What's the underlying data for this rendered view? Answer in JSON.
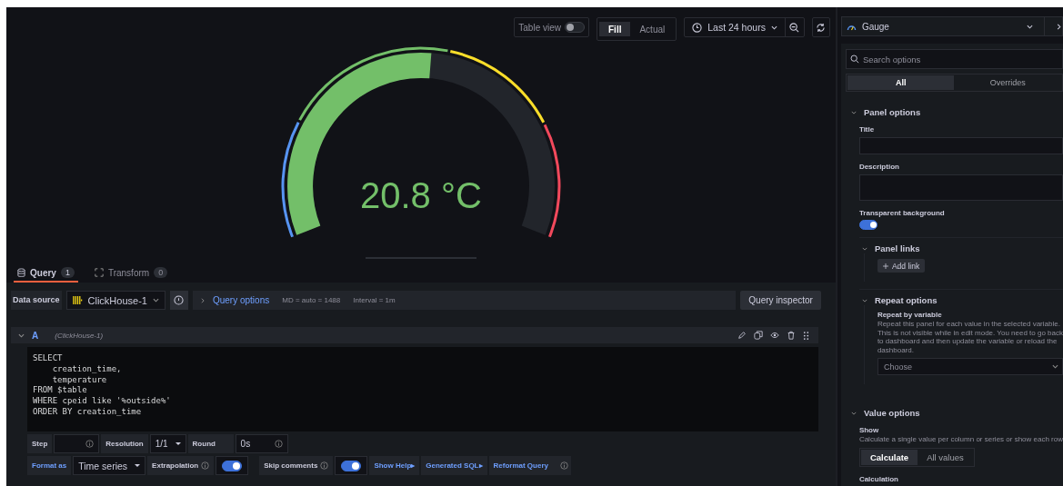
{
  "toolbar": {
    "table_view": {
      "label": "Table view",
      "on": false
    },
    "modes": [
      {
        "label": "Fill",
        "selected": true
      },
      {
        "label": "Actual",
        "selected": false
      }
    ],
    "time_range": "Last 24 hours"
  },
  "gauge": {
    "value": "20.8 °C",
    "level": 0.52
  },
  "query_tabs": [
    {
      "label": "Query",
      "count": "1",
      "selected": true
    },
    {
      "label": "Transform",
      "count": "0",
      "selected": false
    }
  ],
  "data_source": {
    "label": "Data source",
    "value": "ClickHouse-1"
  },
  "query_options": {
    "label": "Query options",
    "md": "MD = auto = 1488",
    "interval": "Interval = 1m"
  },
  "query_inspector": "Query inspector",
  "query": {
    "ref": "A",
    "source": "(ClickHouse-1)",
    "sql": [
      "SELECT",
      "    creation_time,",
      "    temperature",
      "FROM $table",
      "WHERE cpeid like '%outside%'",
      "ORDER BY creation_time"
    ],
    "step": {
      "label": "Step"
    },
    "resolution": {
      "label": "Resolution",
      "value": "1/1"
    },
    "round": {
      "label": "Round",
      "value": "0s"
    },
    "format": {
      "label": "Format as",
      "value": "Time series"
    },
    "extrapolation": {
      "label": "Extrapolation",
      "on": true
    },
    "skip_comments": {
      "label": "Skip comments",
      "on": true
    },
    "links": [
      "Show Help▸",
      "Generated SQL▸",
      "Reformat Query"
    ]
  },
  "visualization": "Gauge",
  "options": {
    "search_placeholder": "Search options",
    "tabs": [
      {
        "label": "All",
        "selected": true
      },
      {
        "label": "Overrides",
        "selected": false
      }
    ],
    "panel_options": {
      "title": "Panel options",
      "expanded": true,
      "title_label": "Title",
      "description_label": "Description",
      "transparent": {
        "label": "Transparent background",
        "on": true
      },
      "links": {
        "title": "Panel links",
        "expanded": true,
        "button": "Add link"
      },
      "repeat": {
        "title": "Repeat options",
        "expanded": true,
        "label": "Repeat by variable",
        "description": "Repeat this panel for each value in the selected variable. This is not visible while in edit mode. You need to go back to dashboard and then update the variable or reload the dashboard.",
        "placeholder": "Choose"
      }
    },
    "value_options": {
      "title": "Value options",
      "expanded": true,
      "show_label": "Show",
      "show_description": "Calculate a single value per column or series or show each row",
      "show_modes": [
        {
          "label": "Calculate",
          "selected": true
        },
        {
          "label": "All values",
          "selected": false
        }
      ],
      "calculation_label": "Calculation"
    }
  }
}
